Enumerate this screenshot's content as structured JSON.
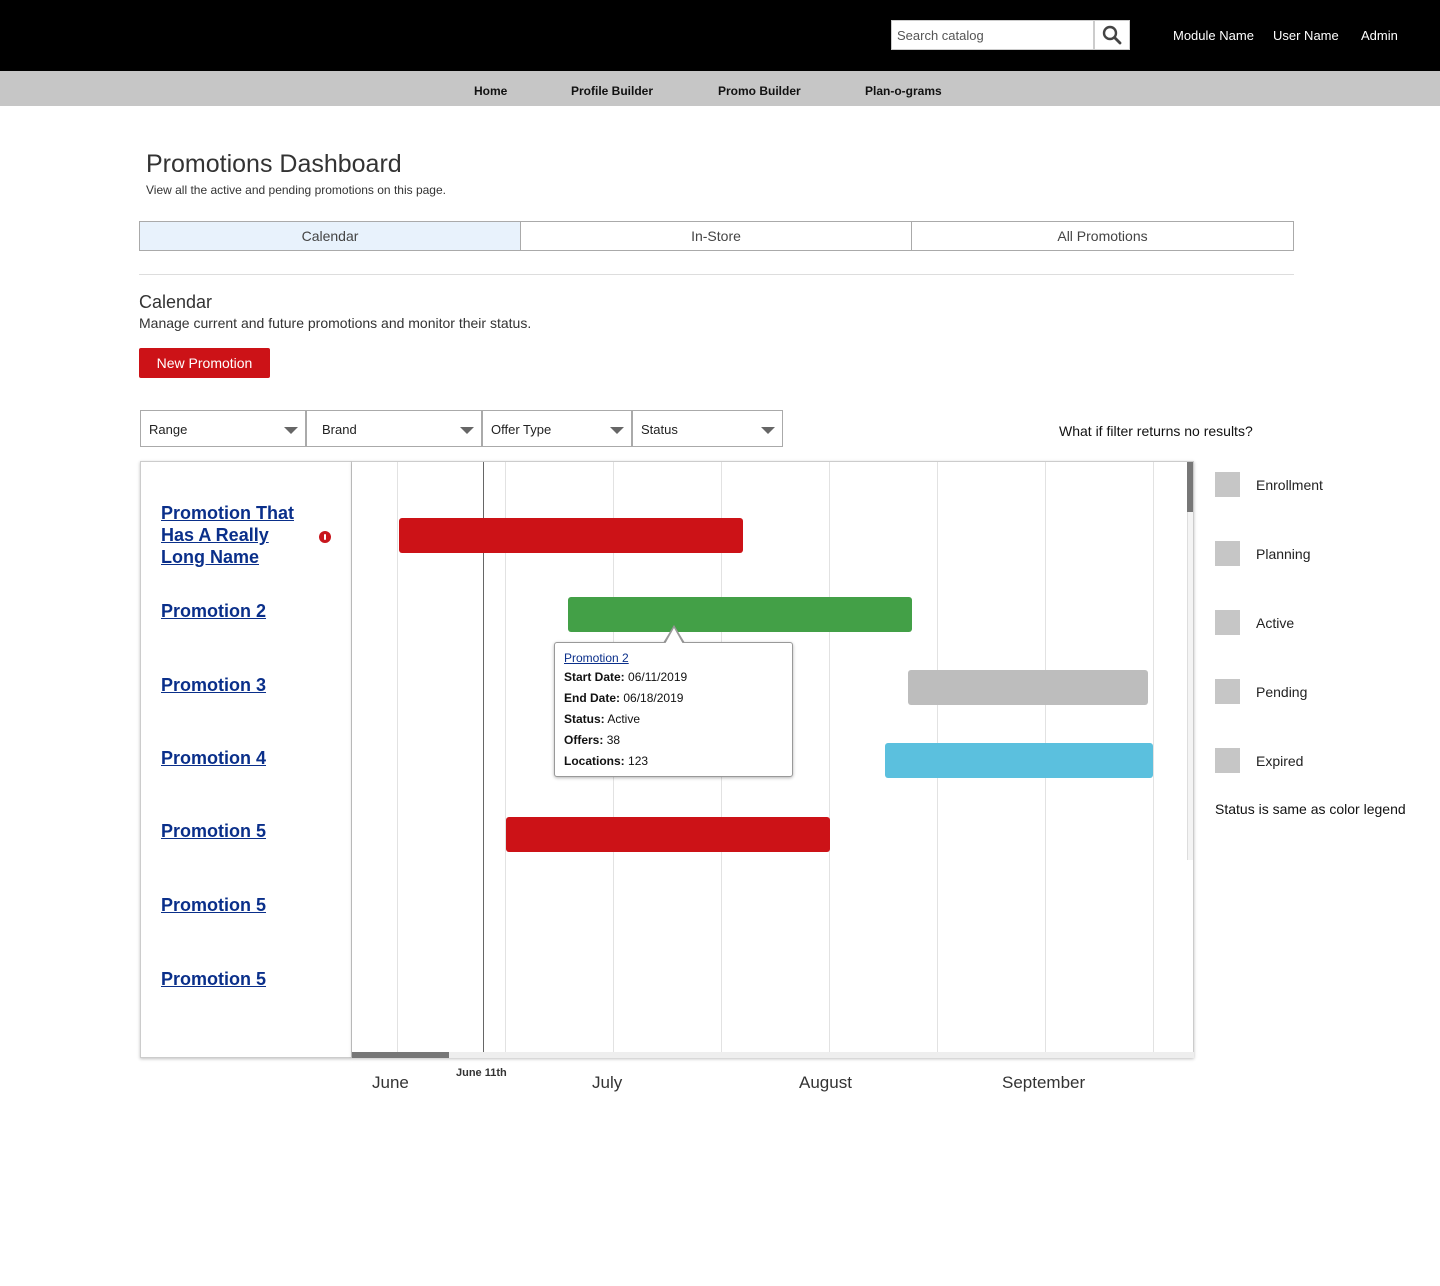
{
  "header": {
    "search_placeholder": "Search catalog",
    "links": [
      "Module Name",
      "User Name",
      "Admin"
    ],
    "search_icon": "search-icon"
  },
  "nav": {
    "items": [
      "Home",
      "Profile Builder",
      "Promo Builder",
      "Plan-o-grams"
    ]
  },
  "page": {
    "title": "Promotions Dashboard",
    "subtitle": "View all the active and pending promotions on this page."
  },
  "tabs": [
    {
      "label": "Calendar",
      "active": true
    },
    {
      "label": "In-Store",
      "active": false
    },
    {
      "label": "All Promotions",
      "active": false
    }
  ],
  "calendar": {
    "title": "Calendar",
    "subtitle": "Manage current and future promotions and monitor their status.",
    "new_button": "New Promotion",
    "filter_note": "What if filter returns no results?",
    "filters": [
      "Range",
      "Brand",
      "Offer Type",
      "Status"
    ],
    "promotions": [
      {
        "name": "Promotion That Has A Really Long Name",
        "alert": true
      },
      {
        "name": "Promotion 2",
        "alert": false
      },
      {
        "name": "Promotion 3",
        "alert": false
      },
      {
        "name": "Promotion 4",
        "alert": false
      },
      {
        "name": "Promotion 5",
        "alert": false
      },
      {
        "name": "Promotion 5",
        "alert": false
      },
      {
        "name": "Promotion 5",
        "alert": false
      }
    ],
    "months": [
      "June",
      "July",
      "August",
      "September"
    ],
    "today_label": "June 11th",
    "colors": {
      "red": "#cc1217",
      "green": "#43a047",
      "gray": "#bdbdbd",
      "blue": "#5bc0de"
    },
    "tooltip": {
      "title": "Promotion 2",
      "rows": [
        {
          "key": "Start Date:",
          "value": "06/11/2019"
        },
        {
          "key": "End Date:",
          "value": "06/18/2019"
        },
        {
          "key": "Status:",
          "value": "Active"
        },
        {
          "key": "Offers:",
          "value": "38"
        },
        {
          "key": "Locations:",
          "value": "123"
        }
      ]
    }
  },
  "legend": {
    "items": [
      "Enrollment",
      "Planning",
      "Active",
      "Pending",
      "Expired"
    ],
    "swatch_color": "#c6c6c6",
    "note": "Status is same as color legend"
  }
}
